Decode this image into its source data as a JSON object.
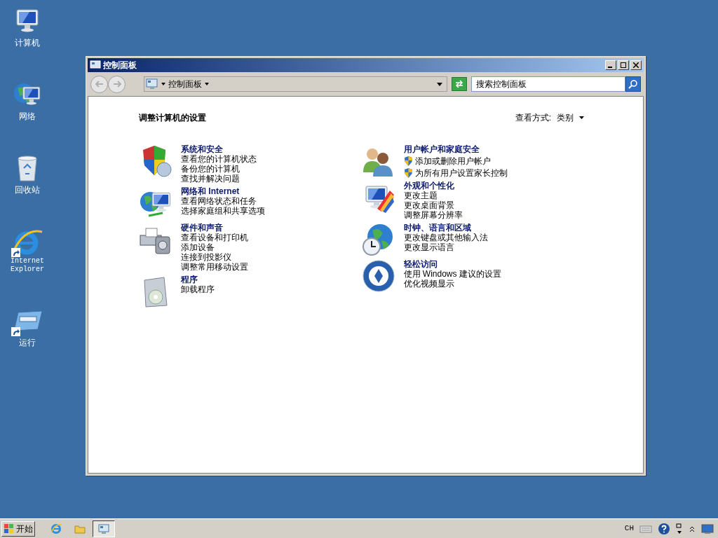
{
  "desktop_icons": [
    {
      "label": "计算机",
      "kind": "computer",
      "shortcut": false
    },
    {
      "label": "网络",
      "kind": "network",
      "shortcut": false
    },
    {
      "label": "回收站",
      "kind": "recycle",
      "shortcut": false
    },
    {
      "label": "Internet Explorer",
      "kind": "ie",
      "shortcut": true
    },
    {
      "label": "运行",
      "kind": "run",
      "shortcut": true
    }
  ],
  "window": {
    "title": "控制面板",
    "breadcrumb": "控制面板",
    "search": {
      "placeholder": "搜索控制面板"
    }
  },
  "header": {
    "title": "调整计算机的设置",
    "view_label": "查看方式:",
    "view_value": "类别"
  },
  "columns": [
    [
      {
        "kind": "security",
        "title": "系统和安全",
        "links": [
          {
            "text": "查看您的计算机状态",
            "shield": false
          },
          {
            "text": "备份您的计算机",
            "shield": false
          },
          {
            "text": "查找并解决问题",
            "shield": false
          }
        ]
      },
      {
        "kind": "network",
        "title": "网络和 Internet",
        "links": [
          {
            "text": "查看网络状态和任务",
            "shield": false
          },
          {
            "text": "选择家庭组和共享选项",
            "shield": false
          }
        ]
      },
      {
        "kind": "hardware",
        "title": "硬件和声音",
        "links": [
          {
            "text": "查看设备和打印机",
            "shield": false
          },
          {
            "text": "添加设备",
            "shield": false
          },
          {
            "text": "连接到投影仪",
            "shield": false
          },
          {
            "text": "调整常用移动设置",
            "shield": false
          }
        ]
      },
      {
        "kind": "programs",
        "title": "程序",
        "links": [
          {
            "text": "卸载程序",
            "shield": false
          }
        ]
      }
    ],
    [
      {
        "kind": "users",
        "title": "用户帐户和家庭安全",
        "links": [
          {
            "text": "添加或删除用户帐户",
            "shield": true
          },
          {
            "text": "为所有用户设置家长控制",
            "shield": true
          }
        ]
      },
      {
        "kind": "appearance",
        "title": "外观和个性化",
        "links": [
          {
            "text": "更改主题",
            "shield": false
          },
          {
            "text": "更改桌面背景",
            "shield": false
          },
          {
            "text": "调整屏幕分辨率",
            "shield": false
          }
        ]
      },
      {
        "kind": "clock",
        "title": "时钟、语言和区域",
        "links": [
          {
            "text": "更改键盘或其他输入法",
            "shield": false
          },
          {
            "text": "更改显示语言",
            "shield": false
          }
        ]
      },
      {
        "kind": "access",
        "title": "轻松访问",
        "links": [
          {
            "text": "使用 Windows 建议的设置",
            "shield": false
          },
          {
            "text": "优化视频显示",
            "shield": false
          }
        ]
      }
    ]
  ],
  "taskbar": {
    "start": "开始",
    "apps": [
      {
        "kind": "ie",
        "selected": false
      },
      {
        "kind": "folder",
        "selected": false
      },
      {
        "kind": "panel",
        "selected": true
      }
    ],
    "language": "CH"
  }
}
